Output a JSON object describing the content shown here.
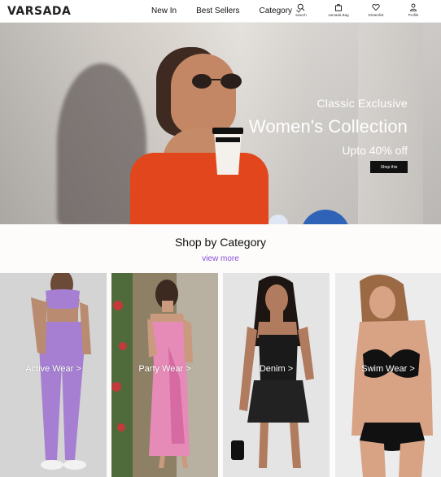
{
  "header": {
    "logo": "VARSADA",
    "nav": [
      {
        "label": "New In"
      },
      {
        "label": "Best Sellers"
      },
      {
        "label": "Category"
      }
    ],
    "icons": [
      {
        "name": "search-icon",
        "label": "search"
      },
      {
        "name": "bag-icon",
        "label": "varsada Bag"
      },
      {
        "name": "heart-icon",
        "label": "Dreamlist"
      },
      {
        "name": "user-icon",
        "label": "Profile"
      }
    ]
  },
  "hero": {
    "kicker": "Classic Exclusive",
    "title": "Women's Collection",
    "offer": "Upto 40% off",
    "cta": "Shop this",
    "slides": 4,
    "active_slide": 1
  },
  "section": {
    "title": "Shop by Category",
    "view_more": "view more"
  },
  "categories": [
    {
      "label": "Active Wear >"
    },
    {
      "label": "Party Wear >"
    },
    {
      "label": "Denim  >"
    },
    {
      "label": "Swim Wear >"
    }
  ]
}
